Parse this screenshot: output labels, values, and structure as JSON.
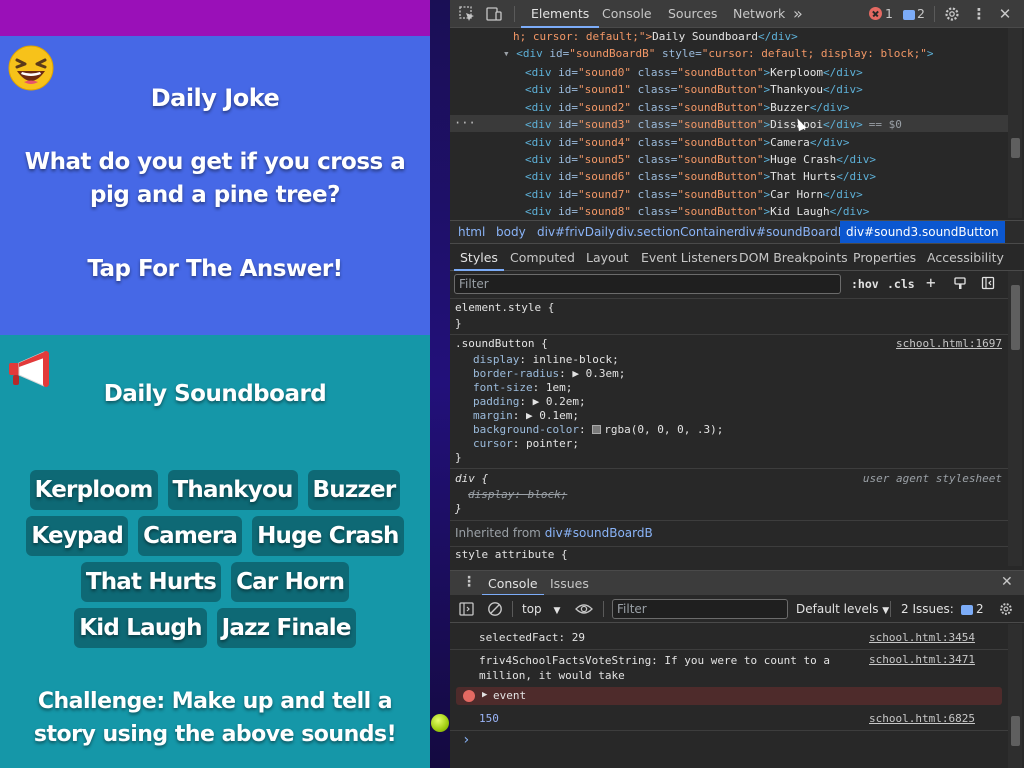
{
  "page": {
    "colors": {
      "topbar": "#9a10b8",
      "joke_bg": "#4668e6",
      "soundboard_bg": "#1597a8"
    },
    "joke": {
      "icon": "laughing-emoji-icon",
      "title": "Daily Joke",
      "question": "What do you get if you cross a pig and a pine tree?",
      "tap": "Tap For The Answer!"
    },
    "soundboard": {
      "icon": "megaphone-icon",
      "title": "Daily Soundboard",
      "buttons": [
        "Kerploom",
        "Thankyou",
        "Buzzer",
        "Keypad",
        "Camera",
        "Huge Crash",
        "That Hurts",
        "Car Horn",
        "Kid Laugh",
        "Jazz Finale"
      ],
      "challenge": "Challenge: Make up and tell a story using the above sounds!"
    }
  },
  "devtools": {
    "toolbar": {
      "tabs": [
        "Elements",
        "Console",
        "Sources",
        "Network"
      ],
      "active_tab": "Elements",
      "more": "»",
      "error_count": "1",
      "message_count": "2"
    },
    "dom": {
      "line0": {
        "pre": "h; cursor: default;\">",
        "text": "Daily Soundboard",
        "close": "</div>"
      },
      "parent": {
        "open": "<div ",
        "id_attr": "id=",
        "id_val": "\"soundBoardB\"",
        "style_attr": " style=",
        "style_val": "\"cursor: default; display: block;\"",
        "end": ">"
      },
      "children": [
        {
          "id": "\"sound0\"",
          "text": "Kerploom"
        },
        {
          "id": "\"sound1\"",
          "text": "Thankyou"
        },
        {
          "id": "\"sound2\"",
          "text": "Buzzer"
        },
        {
          "id": "\"sound3\"",
          "text": "Dissapoi"
        },
        {
          "id": "\"sound4\"",
          "text": "Camera"
        },
        {
          "id": "\"sound5\"",
          "text": "Huge Crash"
        },
        {
          "id": "\"sound6\"",
          "text": "That Hurts"
        },
        {
          "id": "\"sound7\"",
          "text": "Car Horn"
        },
        {
          "id": "\"sound8\"",
          "text": "Kid Laugh"
        }
      ],
      "class_val": "\"soundButton\"",
      "selected_suffix": "== $0",
      "dots": "···"
    },
    "breadcrumbs": [
      "html",
      "body",
      "div#frivDaily",
      "div.sectionContainer",
      "div#soundBoardB",
      "div#sound3.soundButton"
    ],
    "styles_tabs": [
      "Styles",
      "Computed",
      "Layout",
      "Event Listeners",
      "DOM Breakpoints",
      "Properties",
      "Accessibility"
    ],
    "styles": {
      "filter_placeholder": "Filter",
      "hov": ":hov",
      "cls": ".cls",
      "element_style": "element.style {",
      "close": "}",
      "rule_selector": ".soundButton {",
      "rule_source": "school.html:1697",
      "props": [
        {
          "name": "display",
          "value": "inline-block;"
        },
        {
          "name": "border-radius",
          "value": "▶ 0.3em;"
        },
        {
          "name": "font-size",
          "value": "1em;"
        },
        {
          "name": "padding",
          "value": "▶ 0.2em;"
        },
        {
          "name": "margin",
          "value": "▶ 0.1em;"
        },
        {
          "name": "background-color",
          "value": "rgba(0, 0, 0, .3);"
        },
        {
          "name": "cursor",
          "value": "pointer;"
        }
      ],
      "ua_selector": "div {",
      "ua_label": "user agent stylesheet",
      "ua_prop": "display: block;",
      "inherited_label": "Inherited from",
      "inherited_from": "div#soundBoardB",
      "style_attr": "style attribute {"
    },
    "console": {
      "tabs": [
        "Console",
        "Issues"
      ],
      "context": "top",
      "filter_placeholder": "Filter",
      "levels": "Default levels",
      "issues": "2 Issues:",
      "issues_count": "2",
      "logs": [
        {
          "text": "selectedFact: 29",
          "source": "school.html:3454"
        },
        {
          "text": "friv4SchoolFactsVoteString:  If you were to count to a million, it would take",
          "source": "school.html:3471"
        },
        {
          "text": "event",
          "source": ""
        },
        {
          "text": "150",
          "source": "school.html:6825"
        }
      ],
      "prompt": "›"
    }
  }
}
